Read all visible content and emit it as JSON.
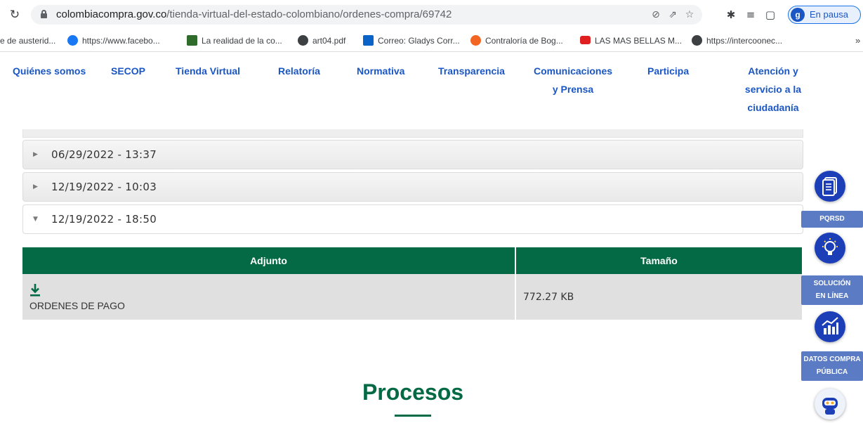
{
  "browser": {
    "url_domain": "colombiacompra.gov.co",
    "url_path": "/tienda-virtual-del-estado-colombiano/ordenes-compra/69742",
    "profile_initial": "g",
    "profile_status": "En pausa",
    "bookmarks": [
      {
        "label": "e de austerid...",
        "icon": "none",
        "color": ""
      },
      {
        "label": "https://www.facebo...",
        "icon": "facebook-icon",
        "color": "#1877f2"
      },
      {
        "label": "La realidad de la co...",
        "icon": "image-icon",
        "color": "#2f6b2a"
      },
      {
        "label": "art04.pdf",
        "icon": "globe-icon",
        "color": "#3c4043"
      },
      {
        "label": "Correo: Gladys Corr...",
        "icon": "outlook-icon",
        "color": "#0a64c8"
      },
      {
        "label": "Contraloría de Bog...",
        "icon": "contraloria-icon",
        "color": "#f26522"
      },
      {
        "label": "LAS MAS BELLAS M...",
        "icon": "youtube-icon",
        "color": "#e02020"
      },
      {
        "label": "https://intercoonec...",
        "icon": "globe-icon",
        "color": "#3c4043"
      }
    ]
  },
  "nav": {
    "items": [
      "Quiénes somos",
      "SECOP",
      "Tienda Virtual",
      "Relatoría",
      "Normativa",
      "Transparencia",
      "Comunicaciones y Prensa",
      "Participa",
      "Atención y servicio a la ciudadanía"
    ],
    "item_lines": [
      [
        "Quiénes somos"
      ],
      [
        "SECOP"
      ],
      [
        "Tienda Virtual"
      ],
      [
        "Relatoría"
      ],
      [
        "Normativa"
      ],
      [
        "Transparencia"
      ],
      [
        "Comunicaciones",
        "y Prensa"
      ],
      [
        "Participa"
      ],
      [
        "Atención y",
        "servicio a la",
        "ciudadanía"
      ]
    ]
  },
  "accordion": {
    "items": [
      {
        "label": "06/29/2022 - 13:37",
        "expanded": false
      },
      {
        "label": "12/19/2022 - 10:03",
        "expanded": false
      },
      {
        "label": "12/19/2022 - 18:50",
        "expanded": true
      }
    ]
  },
  "attachments": {
    "headers": [
      "Adjunto",
      "Tamaño"
    ],
    "rows": [
      {
        "name": "ORDENES DE PAGO",
        "size": "772.27 KB"
      }
    ],
    "header_color": "#036a45"
  },
  "section_title": "Procesos",
  "side_widgets": [
    {
      "icon": "document-icon",
      "label_lines": [
        "PQRSD"
      ]
    },
    {
      "icon": "lightbulb-icon",
      "label_lines": [
        "SOLUCIÓN",
        "EN LÍNEA"
      ]
    },
    {
      "icon": "chart-icon",
      "label_lines": [
        "DATOS COMPRA",
        "PÚBLICA"
      ]
    },
    {
      "icon": "robot-icon",
      "label_lines": []
    }
  ]
}
